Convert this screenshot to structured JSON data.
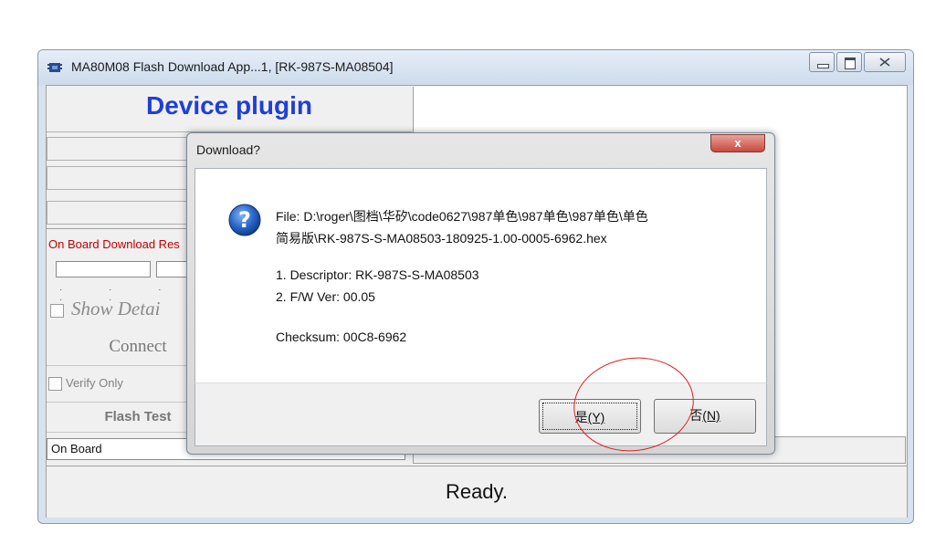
{
  "window": {
    "title": "MA80M08 Flash Download App...1, [RK-987S-MA08504]",
    "app_icon": "app-chip-icon"
  },
  "left_panel": {
    "heading": "Device plugin",
    "result_label": "On Board Download Res",
    "show_detail_label": "Show Detai",
    "connect_label": "Connect",
    "verify_only_label": "Verify Only",
    "flash_test_label": "Flash Test",
    "mode_select_value": "On Board"
  },
  "status": {
    "text": "Ready."
  },
  "dialog": {
    "title": "Download?",
    "icon": "question-icon",
    "file_line_1": "File: D:\\roger\\图档\\华矽\\code0627\\987单色\\987单色\\987单色\\单色",
    "file_line_2": "简易版\\RK-987S-S-MA08503-180925-1.00-0005-6962.hex",
    "descriptor_line": "1. Descriptor: RK-987S-S-MA08503",
    "fw_line": "2. F/W Ver: 00.05",
    "checksum_line": "Checksum: 00C8-6962",
    "yes_label": "是",
    "yes_key": "(Y)",
    "no_label": "否",
    "no_key": "(N)",
    "close_glyph": "x"
  },
  "colors": {
    "heading_blue": "#1f3fd8",
    "result_red": "#c00000",
    "annotation_red": "#e02020",
    "close_red": "#c8493c"
  }
}
